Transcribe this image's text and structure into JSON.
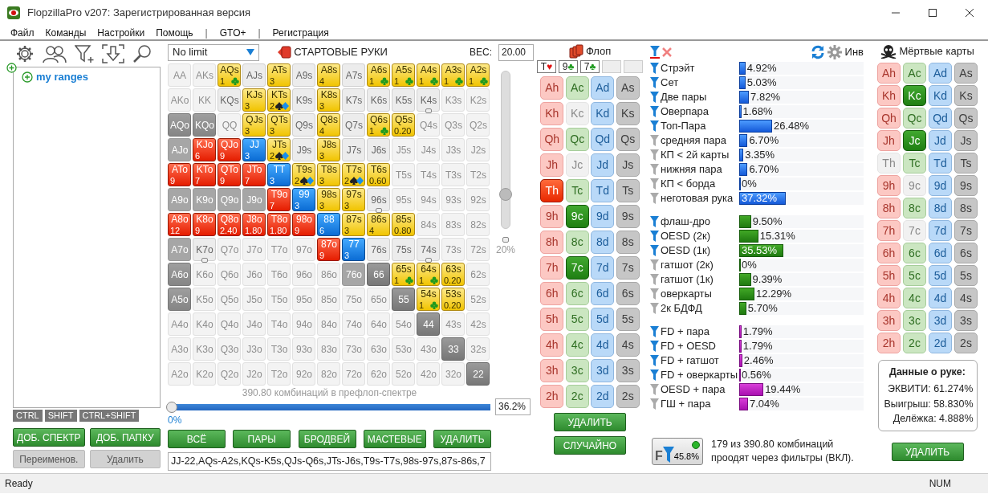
{
  "window": {
    "title": "FlopzillaPro v207: Зарегистрированная версия"
  },
  "menu": [
    {
      "label": "Файл",
      "kind": "item"
    },
    {
      "label": "Команды",
      "kind": "item"
    },
    {
      "label": "Настройки",
      "kind": "item"
    },
    {
      "label": "Помощь",
      "kind": "item"
    },
    {
      "label": "|",
      "kind": "separator"
    },
    {
      "label": "GTO+",
      "kind": "item"
    },
    {
      "label": "|",
      "kind": "separator"
    },
    {
      "label": "Регистрация",
      "kind": "item"
    }
  ],
  "ranges": {
    "tree": [
      {
        "label": "my ranges",
        "expanded": false
      }
    ],
    "modifier_tabs": [
      {
        "label": "CTRL"
      },
      {
        "label": "SHIFT"
      },
      {
        "label": "CTRL+SHIFT"
      }
    ],
    "buttons": [
      {
        "label": "ДОБ. СПЕКТР",
        "disabled": false
      },
      {
        "label": "ДОБ. ПАПКУ",
        "disabled": false
      },
      {
        "label": "Переименов.",
        "disabled": true
      },
      {
        "label": "Удалить",
        "disabled": true
      }
    ]
  },
  "preflop": {
    "game": "No limit",
    "title": "СТАРТОВЫЕ РУКИ",
    "weight_label": "ВЕС:",
    "weight": "20.00",
    "matrix": [
      [
        {
          "label": "AA",
          "kind": "faint"
        },
        {
          "label": "AKs",
          "kind": "faint"
        },
        {
          "label": "AQs",
          "kind": "gold",
          "count": "1",
          "club": true
        },
        {
          "label": "AJs",
          "kind": "plain"
        },
        {
          "label": "ATs",
          "kind": "gold",
          "count": "3"
        },
        {
          "label": "A9s",
          "kind": "plain"
        },
        {
          "label": "A8s",
          "kind": "gold",
          "count": "4"
        },
        {
          "label": "A7s",
          "kind": "plain"
        },
        {
          "label": "A6s",
          "kind": "gold",
          "count": "1",
          "club": true
        },
        {
          "label": "A5s",
          "kind": "gold",
          "count": "1",
          "club": true
        },
        {
          "label": "A4s",
          "kind": "gold",
          "count": "1",
          "club": true
        },
        {
          "label": "A3s",
          "kind": "gold",
          "count": "1",
          "club": true
        },
        {
          "label": "A2s",
          "kind": "gold",
          "count": "1",
          "club": true
        }
      ],
      [
        {
          "label": "AKo",
          "kind": "faint"
        },
        {
          "label": "KK",
          "kind": "faint"
        },
        {
          "label": "KQs",
          "kind": "plain"
        },
        {
          "label": "KJs",
          "kind": "gold",
          "count": "3"
        },
        {
          "label": "KTs",
          "kind": "gold",
          "count": "2",
          "spade_diamond": true
        },
        {
          "label": "K9s",
          "kind": "plain"
        },
        {
          "label": "K8s",
          "kind": "gold",
          "count": "3"
        },
        {
          "label": "K7s",
          "kind": "plain"
        },
        {
          "label": "K6s",
          "kind": "plain"
        },
        {
          "label": "K5s",
          "kind": "plain"
        },
        {
          "label": "K4s",
          "kind": "plain",
          "marker": true
        },
        {
          "label": "K3s",
          "kind": "faint"
        },
        {
          "label": "K2s",
          "kind": "faint"
        }
      ],
      [
        {
          "label": "AQo",
          "kind": "grey"
        },
        {
          "label": "KQo",
          "kind": "grey"
        },
        {
          "label": "QQ",
          "kind": "faint"
        },
        {
          "label": "QJs",
          "kind": "gold",
          "count": "3"
        },
        {
          "label": "QTs",
          "kind": "gold",
          "count": "3"
        },
        {
          "label": "Q9s",
          "kind": "plain"
        },
        {
          "label": "Q8s",
          "kind": "gold",
          "count": "4"
        },
        {
          "label": "Q7s",
          "kind": "plain"
        },
        {
          "label": "Q6s",
          "kind": "gold",
          "count": "1",
          "club": true
        },
        {
          "label": "Q5s",
          "kind": "gold",
          "count": "0.20"
        },
        {
          "label": "Q4s",
          "kind": "faint"
        },
        {
          "label": "Q3s",
          "kind": "faint"
        },
        {
          "label": "Q2s",
          "kind": "faint"
        }
      ],
      [
        {
          "label": "AJo",
          "kind": "mid"
        },
        {
          "label": "KJo",
          "kind": "red",
          "count": "6"
        },
        {
          "label": "QJo",
          "kind": "red",
          "count": "9"
        },
        {
          "label": "JJ",
          "kind": "blue",
          "count": "3"
        },
        {
          "label": "JTs",
          "kind": "gold",
          "count": "2",
          "spade_diamond": true
        },
        {
          "label": "J9s",
          "kind": "plain"
        },
        {
          "label": "J8s",
          "kind": "gold",
          "count": "3"
        },
        {
          "label": "J7s",
          "kind": "plain"
        },
        {
          "label": "J6s",
          "kind": "plain"
        },
        {
          "label": "J5s",
          "kind": "faint"
        },
        {
          "label": "J4s",
          "kind": "faint"
        },
        {
          "label": "J3s",
          "kind": "faint"
        },
        {
          "label": "J2s",
          "kind": "faint"
        }
      ],
      [
        {
          "label": "ATo",
          "kind": "red",
          "count": "9"
        },
        {
          "label": "KTo",
          "kind": "red",
          "count": "7"
        },
        {
          "label": "QTo",
          "kind": "red",
          "count": "9"
        },
        {
          "label": "JTo",
          "kind": "red",
          "count": "7"
        },
        {
          "label": "TT",
          "kind": "blue",
          "count": "3"
        },
        {
          "label": "T9s",
          "kind": "gold",
          "count": "2",
          "spade_diamond": true
        },
        {
          "label": "T8s",
          "kind": "gold",
          "count": "3"
        },
        {
          "label": "T7s",
          "kind": "gold",
          "count": "2",
          "spade_diamond": true
        },
        {
          "label": "T6s",
          "kind": "gold",
          "count": "0.60"
        },
        {
          "label": "T5s",
          "kind": "faint"
        },
        {
          "label": "T4s",
          "kind": "faint"
        },
        {
          "label": "T3s",
          "kind": "faint"
        },
        {
          "label": "T2s",
          "kind": "faint"
        }
      ],
      [
        {
          "label": "A9o",
          "kind": "mid"
        },
        {
          "label": "K9o",
          "kind": "mid"
        },
        {
          "label": "Q9o",
          "kind": "mid"
        },
        {
          "label": "J9o",
          "kind": "mid"
        },
        {
          "label": "T9o",
          "kind": "red",
          "count": "7"
        },
        {
          "label": "99",
          "kind": "blue",
          "count": "3"
        },
        {
          "label": "98s",
          "kind": "gold",
          "count": "3"
        },
        {
          "label": "97s",
          "kind": "gold",
          "count": "3"
        },
        {
          "label": "96s",
          "kind": "plain",
          "marker": true
        },
        {
          "label": "95s",
          "kind": "faint"
        },
        {
          "label": "94s",
          "kind": "faint"
        },
        {
          "label": "93s",
          "kind": "faint"
        },
        {
          "label": "92s",
          "kind": "faint"
        }
      ],
      [
        {
          "label": "A8o",
          "kind": "red",
          "count": "12"
        },
        {
          "label": "K8o",
          "kind": "red",
          "count": "9"
        },
        {
          "label": "Q8o",
          "kind": "red",
          "count": "2.40"
        },
        {
          "label": "J8o",
          "kind": "red",
          "count": "1.80"
        },
        {
          "label": "T8o",
          "kind": "red",
          "count": "1.80"
        },
        {
          "label": "98o",
          "kind": "red",
          "count": "9"
        },
        {
          "label": "88",
          "kind": "blue",
          "count": "6"
        },
        {
          "label": "87s",
          "kind": "gold",
          "count": "3"
        },
        {
          "label": "86s",
          "kind": "gold",
          "count": "4"
        },
        {
          "label": "85s",
          "kind": "gold",
          "count": "0.80"
        },
        {
          "label": "84s",
          "kind": "faint"
        },
        {
          "label": "83s",
          "kind": "faint"
        },
        {
          "label": "82s",
          "kind": "faint"
        }
      ],
      [
        {
          "label": "A7o",
          "kind": "mid"
        },
        {
          "label": "K7o",
          "kind": "plain",
          "marker": true
        },
        {
          "label": "Q7o",
          "kind": "faint"
        },
        {
          "label": "J7o",
          "kind": "faint"
        },
        {
          "label": "T7o",
          "kind": "faint"
        },
        {
          "label": "97o",
          "kind": "faint"
        },
        {
          "label": "87o",
          "kind": "red",
          "count": "9"
        },
        {
          "label": "77",
          "kind": "blue",
          "count": "3"
        },
        {
          "label": "76s",
          "kind": "plain"
        },
        {
          "label": "75s",
          "kind": "plain"
        },
        {
          "label": "74s",
          "kind": "plain",
          "marker": true
        },
        {
          "label": "73s",
          "kind": "faint"
        },
        {
          "label": "72s",
          "kind": "faint"
        }
      ],
      [
        {
          "label": "A6o",
          "kind": "grey"
        },
        {
          "label": "K6o",
          "kind": "faint"
        },
        {
          "label": "Q6o",
          "kind": "faint"
        },
        {
          "label": "J6o",
          "kind": "faint"
        },
        {
          "label": "T6o",
          "kind": "faint"
        },
        {
          "label": "96o",
          "kind": "faint"
        },
        {
          "label": "86o",
          "kind": "faint"
        },
        {
          "label": "76o",
          "kind": "mid"
        },
        {
          "label": "66",
          "kind": "dark"
        },
        {
          "label": "65s",
          "kind": "gold",
          "count": "1",
          "club": true
        },
        {
          "label": "64s",
          "kind": "gold",
          "count": "1",
          "club": true
        },
        {
          "label": "63s",
          "kind": "gold",
          "count": "0.20"
        },
        {
          "label": "62s",
          "kind": "faint"
        }
      ],
      [
        {
          "label": "A5o",
          "kind": "grey"
        },
        {
          "label": "K5o",
          "kind": "faint"
        },
        {
          "label": "Q5o",
          "kind": "faint"
        },
        {
          "label": "J5o",
          "kind": "faint"
        },
        {
          "label": "T5o",
          "kind": "faint"
        },
        {
          "label": "95o",
          "kind": "faint"
        },
        {
          "label": "85o",
          "kind": "faint"
        },
        {
          "label": "75o",
          "kind": "faint"
        },
        {
          "label": "65o",
          "kind": "faint"
        },
        {
          "label": "55",
          "kind": "dark"
        },
        {
          "label": "54s",
          "kind": "gold",
          "count": "1",
          "club": true
        },
        {
          "label": "53s",
          "kind": "gold",
          "count": "0.20"
        },
        {
          "label": "52s",
          "kind": "faint"
        }
      ],
      [
        {
          "label": "A4o",
          "kind": "faint"
        },
        {
          "label": "K4o",
          "kind": "faint"
        },
        {
          "label": "Q4o",
          "kind": "faint"
        },
        {
          "label": "J4o",
          "kind": "faint"
        },
        {
          "label": "T4o",
          "kind": "faint"
        },
        {
          "label": "94o",
          "kind": "faint"
        },
        {
          "label": "84o",
          "kind": "faint"
        },
        {
          "label": "74o",
          "kind": "faint"
        },
        {
          "label": "64o",
          "kind": "faint"
        },
        {
          "label": "54o",
          "kind": "faint"
        },
        {
          "label": "44",
          "kind": "dark"
        },
        {
          "label": "43s",
          "kind": "faint"
        },
        {
          "label": "42s",
          "kind": "faint"
        }
      ],
      [
        {
          "label": "A3o",
          "kind": "faint"
        },
        {
          "label": "K3o",
          "kind": "faint"
        },
        {
          "label": "Q3o",
          "kind": "faint"
        },
        {
          "label": "J3o",
          "kind": "faint"
        },
        {
          "label": "T3o",
          "kind": "faint"
        },
        {
          "label": "93o",
          "kind": "faint"
        },
        {
          "label": "83o",
          "kind": "faint"
        },
        {
          "label": "73o",
          "kind": "faint"
        },
        {
          "label": "63o",
          "kind": "faint"
        },
        {
          "label": "53o",
          "kind": "faint"
        },
        {
          "label": "43o",
          "kind": "faint"
        },
        {
          "label": "33",
          "kind": "dark"
        },
        {
          "label": "32s",
          "kind": "faint"
        }
      ],
      [
        {
          "label": "A2o",
          "kind": "faint"
        },
        {
          "label": "K2o",
          "kind": "faint"
        },
        {
          "label": "Q2o",
          "kind": "faint"
        },
        {
          "label": "J2o",
          "kind": "faint"
        },
        {
          "label": "T2o",
          "kind": "faint"
        },
        {
          "label": "92o",
          "kind": "faint"
        },
        {
          "label": "82o",
          "kind": "faint"
        },
        {
          "label": "72o",
          "kind": "faint"
        },
        {
          "label": "62o",
          "kind": "faint"
        },
        {
          "label": "52o",
          "kind": "faint"
        },
        {
          "label": "42o",
          "kind": "faint"
        },
        {
          "label": "32o",
          "kind": "faint"
        },
        {
          "label": "22",
          "kind": "dark"
        }
      ]
    ],
    "weight_slider": {
      "level": 0.2,
      "reading": "20%"
    },
    "combo_slider": {
      "level": 0,
      "reading": "0%",
      "caption": "390.80 комбинаций в префлоп-спектре",
      "percent": "36.2%"
    },
    "buttons": [
      "ВСЁ",
      "ПАРЫ",
      "БРОДВЕЙ",
      "МАСТЕВЫЕ",
      "УДАЛИТЬ"
    ],
    "range_text": "JJ-22,AQs-A2s,KQs-K5s,QJs-Q6s,JTs-J6s,T9s-T7s,98s-97s,87s-86s,7"
  },
  "flop": {
    "title": "Флоп",
    "board": [
      {
        "kind": "card",
        "rank": "T",
        "suit": "♥",
        "color": "#e01010"
      },
      {
        "kind": "card",
        "rank": "9",
        "suit": "♣",
        "color": "#1f9a1f"
      },
      {
        "kind": "card",
        "rank": "7",
        "suit": "♣",
        "color": "#1f9a1f"
      },
      {
        "kind": "empty"
      },
      {
        "kind": "empty"
      }
    ],
    "cards": [
      [
        {
          "label": "Ah",
          "kind": "hearts",
          "selected": false,
          "disabled": false
        },
        {
          "label": "Ac",
          "kind": "clubs",
          "selected": false,
          "disabled": false
        },
        {
          "label": "Ad",
          "kind": "diamonds",
          "selected": false,
          "disabled": false
        },
        {
          "label": "As",
          "kind": "spades",
          "selected": false,
          "disabled": false
        }
      ],
      [
        {
          "label": "Kh",
          "kind": "hearts",
          "selected": false,
          "disabled": false
        },
        {
          "label": "Kc",
          "kind": "clubs",
          "selected": false,
          "disabled": true
        },
        {
          "label": "Kd",
          "kind": "diamonds",
          "selected": false,
          "disabled": false
        },
        {
          "label": "Ks",
          "kind": "spades",
          "selected": false,
          "disabled": false
        }
      ],
      [
        {
          "label": "Qh",
          "kind": "hearts",
          "selected": false,
          "disabled": false
        },
        {
          "label": "Qc",
          "kind": "clubs",
          "selected": false,
          "disabled": false
        },
        {
          "label": "Qd",
          "kind": "diamonds",
          "selected": false,
          "disabled": false
        },
        {
          "label": "Qs",
          "kind": "spades",
          "selected": false,
          "disabled": false
        }
      ],
      [
        {
          "label": "Jh",
          "kind": "hearts",
          "selected": false,
          "disabled": false
        },
        {
          "label": "Jc",
          "kind": "clubs",
          "selected": false,
          "disabled": true
        },
        {
          "label": "Jd",
          "kind": "diamonds",
          "selected": false,
          "disabled": false
        },
        {
          "label": "Js",
          "kind": "spades",
          "selected": false,
          "disabled": false
        }
      ],
      [
        {
          "label": "Th",
          "kind": "hearts",
          "selected": true,
          "disabled": false
        },
        {
          "label": "Tc",
          "kind": "clubs",
          "selected": false,
          "disabled": false
        },
        {
          "label": "Td",
          "kind": "diamonds",
          "selected": false,
          "disabled": false
        },
        {
          "label": "Ts",
          "kind": "spades",
          "selected": false,
          "disabled": false
        }
      ],
      [
        {
          "label": "9h",
          "kind": "hearts",
          "selected": false,
          "disabled": false
        },
        {
          "label": "9c",
          "kind": "clubs",
          "selected": true,
          "disabled": false
        },
        {
          "label": "9d",
          "kind": "diamonds",
          "selected": false,
          "disabled": false
        },
        {
          "label": "9s",
          "kind": "spades",
          "selected": false,
          "disabled": false
        }
      ],
      [
        {
          "label": "8h",
          "kind": "hearts",
          "selected": false,
          "disabled": false
        },
        {
          "label": "8c",
          "kind": "clubs",
          "selected": false,
          "disabled": false
        },
        {
          "label": "8d",
          "kind": "diamonds",
          "selected": false,
          "disabled": false
        },
        {
          "label": "8s",
          "kind": "spades",
          "selected": false,
          "disabled": false
        }
      ],
      [
        {
          "label": "7h",
          "kind": "hearts",
          "selected": false,
          "disabled": false
        },
        {
          "label": "7c",
          "kind": "clubs",
          "selected": true,
          "disabled": false
        },
        {
          "label": "7d",
          "kind": "diamonds",
          "selected": false,
          "disabled": false
        },
        {
          "label": "7s",
          "kind": "spades",
          "selected": false,
          "disabled": false
        }
      ],
      [
        {
          "label": "6h",
          "kind": "hearts",
          "selected": false,
          "disabled": false
        },
        {
          "label": "6c",
          "kind": "clubs",
          "selected": false,
          "disabled": false
        },
        {
          "label": "6d",
          "kind": "diamonds",
          "selected": false,
          "disabled": false
        },
        {
          "label": "6s",
          "kind": "spades",
          "selected": false,
          "disabled": false
        }
      ],
      [
        {
          "label": "5h",
          "kind": "hearts",
          "selected": false,
          "disabled": false
        },
        {
          "label": "5c",
          "kind": "clubs",
          "selected": false,
          "disabled": false
        },
        {
          "label": "5d",
          "kind": "diamonds",
          "selected": false,
          "disabled": false
        },
        {
          "label": "5s",
          "kind": "spades",
          "selected": false,
          "disabled": false
        }
      ],
      [
        {
          "label": "4h",
          "kind": "hearts",
          "selected": false,
          "disabled": false
        },
        {
          "label": "4c",
          "kind": "clubs",
          "selected": false,
          "disabled": false
        },
        {
          "label": "4d",
          "kind": "diamonds",
          "selected": false,
          "disabled": false
        },
        {
          "label": "4s",
          "kind": "spades",
          "selected": false,
          "disabled": false
        }
      ],
      [
        {
          "label": "3h",
          "kind": "hearts",
          "selected": false,
          "disabled": false
        },
        {
          "label": "3c",
          "kind": "clubs",
          "selected": false,
          "disabled": false
        },
        {
          "label": "3d",
          "kind": "diamonds",
          "selected": false,
          "disabled": false
        },
        {
          "label": "3s",
          "kind": "spades",
          "selected": false,
          "disabled": false
        }
      ],
      [
        {
          "label": "2h",
          "kind": "hearts",
          "selected": false,
          "disabled": false
        },
        {
          "label": "2c",
          "kind": "clubs",
          "selected": false,
          "disabled": false
        },
        {
          "label": "2d",
          "kind": "diamonds",
          "selected": false,
          "disabled": false
        },
        {
          "label": "2s",
          "kind": "spades",
          "selected": false,
          "disabled": false
        }
      ]
    ],
    "buttons": [
      "УДАЛИТЬ",
      "СЛУЧАЙНО"
    ]
  },
  "stats": {
    "invert_label": "Инв",
    "groups": [
      {
        "kind": "made",
        "items": [
          {
            "label": "Стрэйт",
            "active": true,
            "value": "4.92%",
            "level": 0.0492
          },
          {
            "label": "Сет",
            "active": true,
            "value": "5.03%",
            "level": 0.0503
          },
          {
            "label": "Две пары",
            "active": true,
            "value": "7.82%",
            "level": 0.0782
          },
          {
            "label": "Оверпара",
            "active": true,
            "value": "1.68%",
            "level": 0.0168
          },
          {
            "label": "Топ-Пара",
            "active": true,
            "value": "26.48%",
            "level": 0.2648
          },
          {
            "label": "средняя пара",
            "active": false,
            "value": "6.70%",
            "level": 0.067
          },
          {
            "label": "КП < 2й карты",
            "active": false,
            "value": "3.35%",
            "level": 0.0335
          },
          {
            "label": "нижняя пара",
            "active": false,
            "value": "6.70%",
            "level": 0.067
          },
          {
            "label": "КП < борда",
            "active": false,
            "value": "0%",
            "level": 0
          },
          {
            "label": "неготовая рука",
            "active": false,
            "value": "37.32%",
            "level": 0.3732
          }
        ]
      },
      {
        "kind": "draws",
        "items": [
          {
            "label": "флаш-дро",
            "active": true,
            "value": "9.50%",
            "level": 0.095
          },
          {
            "label": "OESD (2к)",
            "active": true,
            "value": "15.31%",
            "level": 0.1531
          },
          {
            "label": "OESD (1к)",
            "active": true,
            "value": "35.53%",
            "level": 0.3553
          },
          {
            "label": "гатшот (2к)",
            "active": false,
            "value": "0%",
            "level": 0
          },
          {
            "label": "гатшот (1к)",
            "active": false,
            "value": "9.39%",
            "level": 0.0939
          },
          {
            "label": "оверкарты",
            "active": false,
            "value": "12.29%",
            "level": 0.1229
          },
          {
            "label": "2к БДФД",
            "active": false,
            "value": "5.70%",
            "level": 0.057
          }
        ]
      },
      {
        "kind": "combos",
        "items": [
          {
            "label": "FD + пара",
            "active": true,
            "value": "1.79%",
            "level": 0.0179
          },
          {
            "label": "FD + OESD",
            "active": true,
            "value": "1.79%",
            "level": 0.0179
          },
          {
            "label": "FD + гатшот",
            "active": true,
            "value": "2.46%",
            "level": 0.0246
          },
          {
            "label": "FD + оверкарты",
            "active": true,
            "value": "0.56%",
            "level": 0.0056
          },
          {
            "label": "OESD + пара",
            "active": false,
            "value": "19.44%",
            "level": 0.1944
          },
          {
            "label": "ГШ + пара",
            "active": false,
            "value": "7.04%",
            "level": 0.0704
          }
        ]
      }
    ],
    "filter_button": {
      "letter": "F",
      "reading": "45.8%",
      "on": true
    },
    "summary": "179 из 390.80 комбинаций проодят через фильтры (ВКЛ)."
  },
  "dead": {
    "title": "Мёртвые карты",
    "cards": [
      [
        {
          "label": "Ah",
          "kind": "hearts",
          "selected": false,
          "disabled": false
        },
        {
          "label": "Ac",
          "kind": "clubs",
          "selected": false,
          "disabled": false
        },
        {
          "label": "Ad",
          "kind": "diamonds",
          "selected": false,
          "disabled": false
        },
        {
          "label": "As",
          "kind": "spades",
          "selected": false,
          "disabled": false
        }
      ],
      [
        {
          "label": "Kh",
          "kind": "hearts",
          "selected": false,
          "disabled": false
        },
        {
          "label": "Kc",
          "kind": "clubs",
          "selected": true,
          "disabled": false
        },
        {
          "label": "Kd",
          "kind": "diamonds",
          "selected": false,
          "disabled": false
        },
        {
          "label": "Ks",
          "kind": "spades",
          "selected": false,
          "disabled": false
        }
      ],
      [
        {
          "label": "Qh",
          "kind": "hearts",
          "selected": false,
          "disabled": false
        },
        {
          "label": "Qc",
          "kind": "clubs",
          "selected": false,
          "disabled": false
        },
        {
          "label": "Qd",
          "kind": "diamonds",
          "selected": false,
          "disabled": false
        },
        {
          "label": "Qs",
          "kind": "spades",
          "selected": false,
          "disabled": false
        }
      ],
      [
        {
          "label": "Jh",
          "kind": "hearts",
          "selected": false,
          "disabled": false
        },
        {
          "label": "Jc",
          "kind": "clubs",
          "selected": true,
          "disabled": false
        },
        {
          "label": "Jd",
          "kind": "diamonds",
          "selected": false,
          "disabled": false
        },
        {
          "label": "Js",
          "kind": "spades",
          "selected": false,
          "disabled": false
        }
      ],
      [
        {
          "label": "Th",
          "kind": "hearts",
          "selected": false,
          "disabled": true
        },
        {
          "label": "Tc",
          "kind": "clubs",
          "selected": false,
          "disabled": false
        },
        {
          "label": "Td",
          "kind": "diamonds",
          "selected": false,
          "disabled": false
        },
        {
          "label": "Ts",
          "kind": "spades",
          "selected": false,
          "disabled": false
        }
      ],
      [
        {
          "label": "9h",
          "kind": "hearts",
          "selected": false,
          "disabled": false
        },
        {
          "label": "9c",
          "kind": "clubs",
          "selected": false,
          "disabled": true
        },
        {
          "label": "9d",
          "kind": "diamonds",
          "selected": false,
          "disabled": false
        },
        {
          "label": "9s",
          "kind": "spades",
          "selected": false,
          "disabled": false
        }
      ],
      [
        {
          "label": "8h",
          "kind": "hearts",
          "selected": false,
          "disabled": false
        },
        {
          "label": "8c",
          "kind": "clubs",
          "selected": false,
          "disabled": false
        },
        {
          "label": "8d",
          "kind": "diamonds",
          "selected": false,
          "disabled": false
        },
        {
          "label": "8s",
          "kind": "spades",
          "selected": false,
          "disabled": false
        }
      ],
      [
        {
          "label": "7h",
          "kind": "hearts",
          "selected": false,
          "disabled": false
        },
        {
          "label": "7c",
          "kind": "clubs",
          "selected": false,
          "disabled": true
        },
        {
          "label": "7d",
          "kind": "diamonds",
          "selected": false,
          "disabled": false
        },
        {
          "label": "7s",
          "kind": "spades",
          "selected": false,
          "disabled": false
        }
      ],
      [
        {
          "label": "6h",
          "kind": "hearts",
          "selected": false,
          "disabled": false
        },
        {
          "label": "6c",
          "kind": "clubs",
          "selected": false,
          "disabled": false
        },
        {
          "label": "6d",
          "kind": "diamonds",
          "selected": false,
          "disabled": false
        },
        {
          "label": "6s",
          "kind": "spades",
          "selected": false,
          "disabled": false
        }
      ],
      [
        {
          "label": "5h",
          "kind": "hearts",
          "selected": false,
          "disabled": false
        },
        {
          "label": "5c",
          "kind": "clubs",
          "selected": false,
          "disabled": false
        },
        {
          "label": "5d",
          "kind": "diamonds",
          "selected": false,
          "disabled": false
        },
        {
          "label": "5s",
          "kind": "spades",
          "selected": false,
          "disabled": false
        }
      ],
      [
        {
          "label": "4h",
          "kind": "hearts",
          "selected": false,
          "disabled": false
        },
        {
          "label": "4c",
          "kind": "clubs",
          "selected": false,
          "disabled": false
        },
        {
          "label": "4d",
          "kind": "diamonds",
          "selected": false,
          "disabled": false
        },
        {
          "label": "4s",
          "kind": "spades",
          "selected": false,
          "disabled": false
        }
      ],
      [
        {
          "label": "3h",
          "kind": "hearts",
          "selected": false,
          "disabled": false
        },
        {
          "label": "3c",
          "kind": "clubs",
          "selected": false,
          "disabled": false
        },
        {
          "label": "3d",
          "kind": "diamonds",
          "selected": false,
          "disabled": false
        },
        {
          "label": "3s",
          "kind": "spades",
          "selected": false,
          "disabled": false
        }
      ],
      [
        {
          "label": "2h",
          "kind": "hearts",
          "selected": false,
          "disabled": false
        },
        {
          "label": "2c",
          "kind": "clubs",
          "selected": false,
          "disabled": false
        },
        {
          "label": "2d",
          "kind": "diamonds",
          "selected": false,
          "disabled": false
        },
        {
          "label": "2s",
          "kind": "spades",
          "selected": false,
          "disabled": false
        }
      ]
    ],
    "hand_data": {
      "title": "Данные о руке:",
      "lines": [
        "ЭКВИТИ: 61.274%",
        "Выигрыш: 58.830%",
        "Делёжка: 4.888%"
      ]
    },
    "button": "УДАЛИТЬ"
  },
  "status_bar": {
    "left": "Ready",
    "right": "NUM"
  }
}
